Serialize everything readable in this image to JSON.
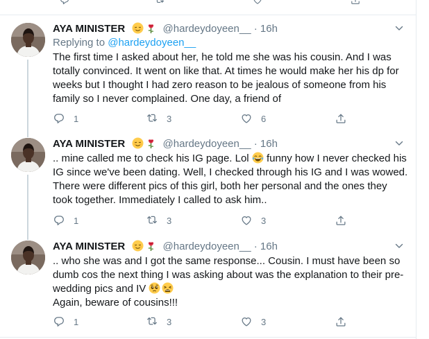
{
  "icons": {
    "reply": "reply-icon",
    "retweet": "retweet-icon",
    "like": "heart-icon",
    "share": "share-icon",
    "more": "chevron-down-icon",
    "avatar": "avatar"
  },
  "colors": {
    "text": "#14171a",
    "muted": "#657786",
    "link": "#1da1f2",
    "border": "#e6ecf0",
    "thread_line": "#ccd6dd"
  },
  "tweets": [
    {
      "author_name": "AYA MINISTER",
      "author_emojis": [
        "relieved-face-emoji",
        "rose-emoji"
      ],
      "handle": "@hardeydoyeen__",
      "dot": "·",
      "time": "16h",
      "replying_prefix": "Replying to",
      "replying_handle": "@hardeydoyeen__",
      "text_parts": [
        "The first time I asked about her, he told me she was his cousin. And I was totally convinced. It went on like that. At times he would make her his dp for weeks but I thought I had zero reason to be jealous of someone from his family so I never complained. One day, a friend of"
      ],
      "reply_count": "1",
      "retweet_count": "3",
      "like_count": "6"
    },
    {
      "author_name": "AYA MINISTER",
      "author_emojis": [
        "relieved-face-emoji",
        "rose-emoji"
      ],
      "handle": "@hardeydoyeen__",
      "dot": "·",
      "time": "16h",
      "text_parts": [
        ".. mine called me to check his IG page. Lol",
        " funny how I never checked his IG since we've been dating. Well, I checked through his IG and I was wowed. There were different pics of this girl, both her personal and the ones they took together. Immediately I called to ask him.."
      ],
      "text_emojis": [
        "face-with-tears-of-joy-emoji"
      ],
      "reply_count": "1",
      "retweet_count": "3",
      "like_count": "3"
    },
    {
      "author_name": "AYA MINISTER",
      "author_emojis": [
        "relieved-face-emoji",
        "rose-emoji"
      ],
      "handle": "@hardeydoyeen__",
      "dot": "·",
      "time": "16h",
      "text_parts": [
        ".. who she was and I got the same response... Cousin. I must have been so dumb cos the next thing I was asking about was the explanation to their pre-wedding pics and IV",
        "Again, beware of cousins!!!"
      ],
      "text_emojis": [
        "pleading-face-emoji",
        "weary-face-emoji"
      ],
      "reply_count": "1",
      "retweet_count": "3",
      "like_count": "3"
    }
  ]
}
